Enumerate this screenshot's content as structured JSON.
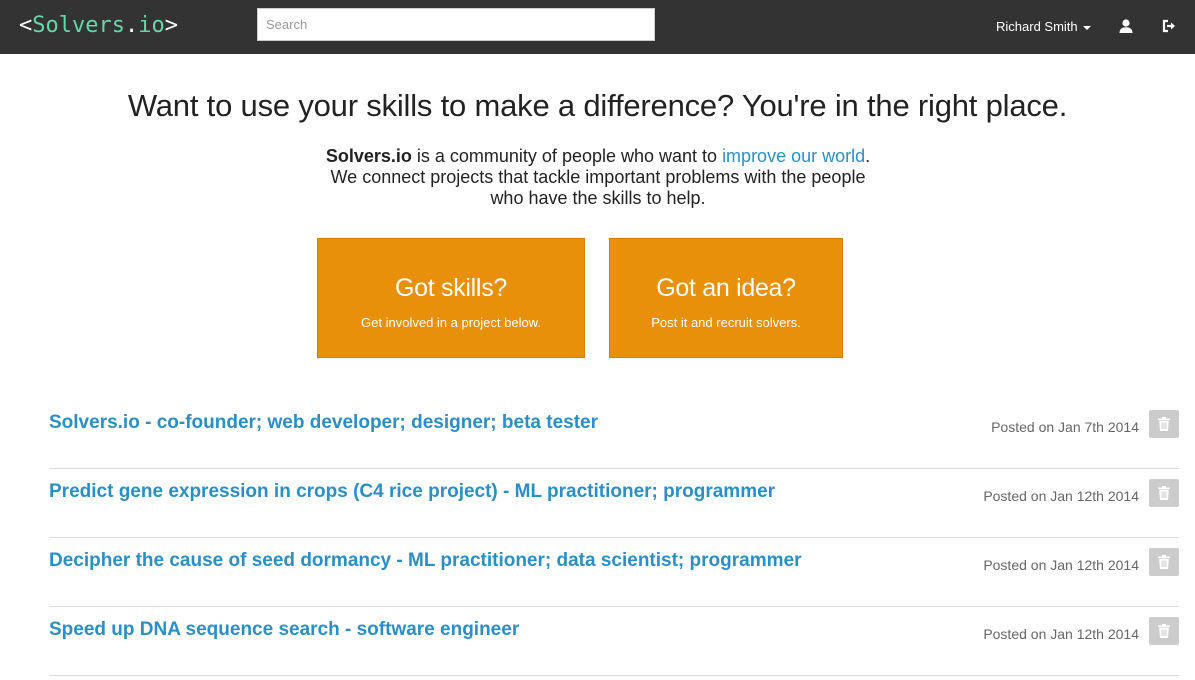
{
  "navbar": {
    "brand": {
      "open": "<",
      "name": "Solvers",
      "dot": ".",
      "tld": "io",
      "close": ">"
    },
    "search": {
      "placeholder": "Search",
      "value": ""
    },
    "user_name": "Richard Smith",
    "icons": [
      "user-icon",
      "logout-icon"
    ],
    "colors": {
      "background": "#333333",
      "brand_accent": "#65d7a8"
    }
  },
  "hero": {
    "title": "Want to use your skills to make a difference? You're in the right place.",
    "brand_bold": "Solvers.io",
    "text_part1": " is a community of people who want to ",
    "link_text": "improve our world",
    "text_part2": ". We connect projects that tackle important problems with the people who have the skills to help."
  },
  "cta": [
    {
      "title": "Got skills?",
      "subtitle": "Get involved in a project below."
    },
    {
      "title": "Got an idea?",
      "subtitle": "Post it and recruit solvers."
    }
  ],
  "projects": [
    {
      "title": "Solvers.io - co-founder; web developer; designer; beta tester",
      "posted": "Posted on Jan 7th 2014"
    },
    {
      "title": "Predict gene expression in crops (C4 rice project) - ML practitioner; programmer",
      "posted": "Posted on Jan 12th 2014"
    },
    {
      "title": "Decipher the cause of seed dormancy - ML practitioner; data scientist; programmer",
      "posted": "Posted on Jan 12th 2014"
    },
    {
      "title": "Speed up DNA sequence search - software engineer",
      "posted": "Posted on Jan 12th 2014"
    }
  ],
  "colors": {
    "link": "#2a8fc7",
    "cta": "#e8900a",
    "delete_button": "#cccccc"
  }
}
